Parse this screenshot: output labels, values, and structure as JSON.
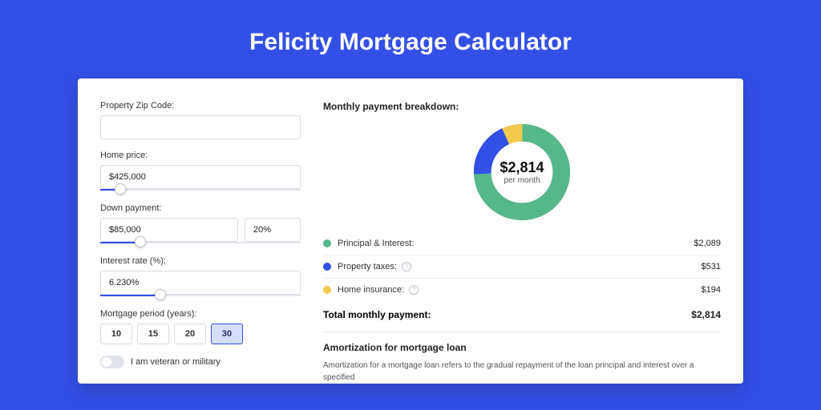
{
  "page": {
    "title": "Felicity Mortgage Calculator"
  },
  "form": {
    "zip": {
      "label": "Property Zip Code:",
      "value": ""
    },
    "home_price": {
      "label": "Home price:",
      "value": "$425,000",
      "slider_pct": 10
    },
    "down_payment": {
      "label": "Down payment:",
      "amount": "$85,000",
      "pct": "20%",
      "slider_pct": 20
    },
    "interest": {
      "label": "Interest rate (%):",
      "value": "6.230%",
      "slider_pct": 30
    },
    "period": {
      "label": "Mortgage period (years):",
      "options": [
        "10",
        "15",
        "20",
        "30"
      ],
      "selected": "30"
    },
    "veteran": {
      "label": "I am veteran or military",
      "value": false
    }
  },
  "breakdown": {
    "title": "Monthly payment breakdown:",
    "center_value": "$2,814",
    "center_sub": "per month",
    "items": [
      {
        "label": "Principal & Interest:",
        "value": "$2,089",
        "color": "#56b78b",
        "info": false
      },
      {
        "label": "Property taxes:",
        "value": "$531",
        "color": "#3250e6",
        "info": true
      },
      {
        "label": "Home insurance:",
        "value": "$194",
        "color": "#f2c94c",
        "info": true
      }
    ],
    "total_label": "Total monthly payment:",
    "total_value": "$2,814"
  },
  "chart_data": {
    "type": "pie",
    "title": "Monthly payment breakdown",
    "series": [
      {
        "name": "Principal & Interest",
        "value": 2089,
        "color": "#56b78b"
      },
      {
        "name": "Property taxes",
        "value": 531,
        "color": "#3250e6"
      },
      {
        "name": "Home insurance",
        "value": 194,
        "color": "#f2c94c"
      }
    ],
    "total": 2814,
    "unit": "USD/month"
  },
  "amort": {
    "title": "Amortization for mortgage loan",
    "body": "Amortization for a mortgage loan refers to the gradual repayment of the loan principal and interest over a specified"
  }
}
